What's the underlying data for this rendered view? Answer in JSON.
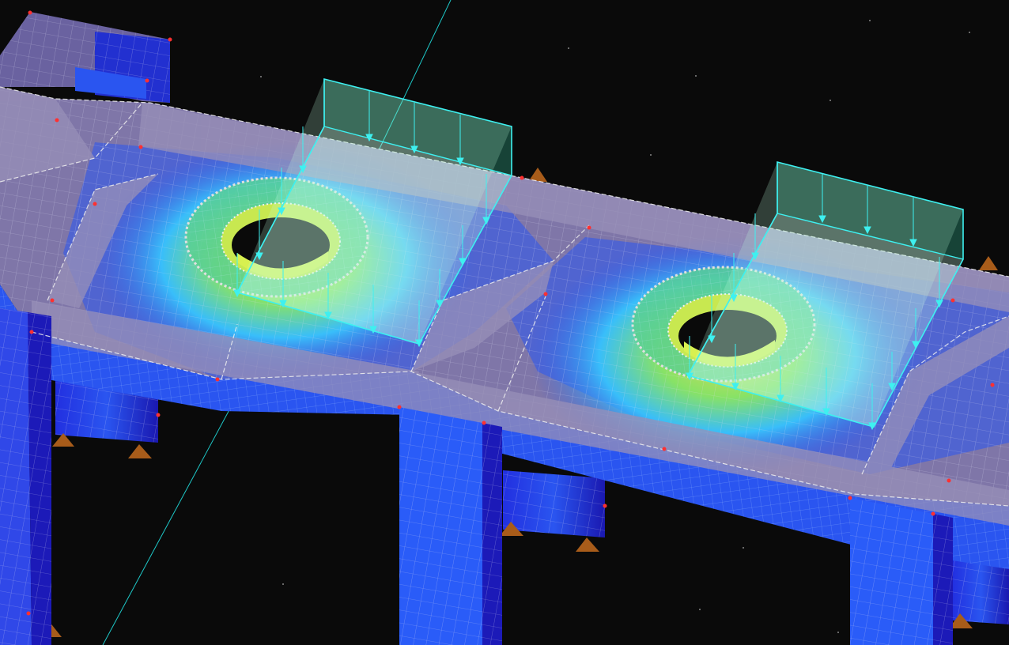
{
  "scene": {
    "background": "#0a0a0a",
    "colors": {
      "deep_blue": "#1a14c8",
      "mid_blue": "#2a55f0",
      "light_blue": "#36a8ff",
      "cyan": "#2ee6e6",
      "green": "#6cf26a",
      "yellow": "#e8e84a",
      "orange": "#e87a2a",
      "slab_gray": "#8a7fa0",
      "mesh_line": "#e8e8f0",
      "support": "#a85c1a",
      "node": "#ff3030",
      "load": "#3ef0f0"
    },
    "objects": {
      "slab": "slab",
      "columns": "columns",
      "openings": "circular-openings",
      "loads": "area-loads",
      "supports": "supports",
      "axis_line": "axis-line"
    }
  }
}
